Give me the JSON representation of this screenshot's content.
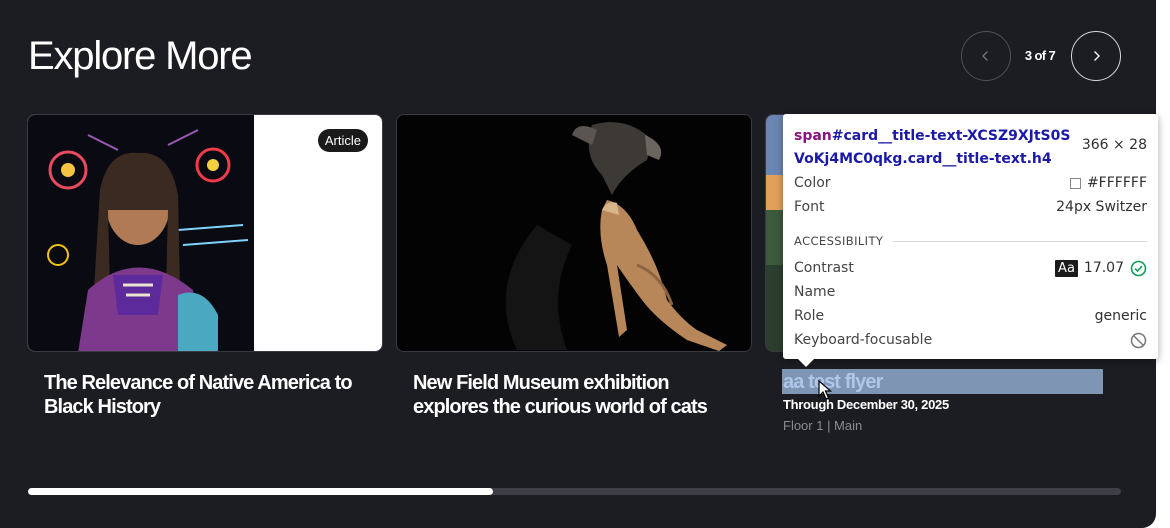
{
  "header": {
    "title": "Explore More",
    "pager": "3 of 7",
    "prev_icon": "chevron-left-icon",
    "next_icon": "chevron-right-icon"
  },
  "cards": [
    {
      "badge": "Article",
      "title": "The Relevance of Native America to Black History",
      "image": "native-woman-painting"
    },
    {
      "title": "New Field Museum exhibition explores the curious world of cats",
      "image": "mountain-lion-and-eagle"
    },
    {
      "title": "aa test flyer",
      "date": "Through December 30, 2025",
      "location": "Floor 1 | Main",
      "image": "landscape-sunset"
    }
  ],
  "carousel": {
    "progress": 0.425
  },
  "inspector": {
    "tag": "span",
    "selector": "#card__title-text-XCSZ9XJtS0SVoKj4MC0qkg.card__title-text.h4",
    "size": "366 × 28",
    "color_label": "Color",
    "color_value": "#FFFFFF",
    "font_label": "Font",
    "font_value": "24px Switzer",
    "section": "ACCESSIBILITY",
    "contrast_label": "Contrast",
    "contrast_chip": "Aa",
    "contrast_value": "17.07",
    "name_label": "Name",
    "role_label": "Role",
    "role_value": "generic",
    "focusable_label": "Keyboard-focusable",
    "colors": {
      "tag": "#881280",
      "selector": "#1a1aa6",
      "pass": "#0f9d58"
    }
  }
}
